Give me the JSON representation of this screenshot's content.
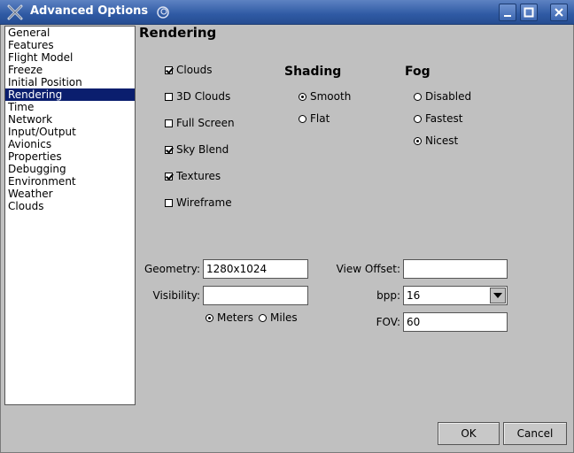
{
  "window": {
    "title": "Advanced Options"
  },
  "sidebar": {
    "items": [
      "General",
      "Features",
      "Flight Model",
      "Freeze",
      "Initial Position",
      "Rendering",
      "Time",
      "Network",
      "Input/Output",
      "Avionics",
      "Properties",
      "Debugging",
      "Environment",
      "Weather",
      "Clouds"
    ],
    "selected": "Rendering"
  },
  "panel": {
    "heading": "Rendering"
  },
  "options": {
    "clouds": {
      "label": "Clouds",
      "checked": true
    },
    "clouds3d": {
      "label": "3D Clouds",
      "checked": false
    },
    "fullscreen": {
      "label": "Full Screen",
      "checked": false
    },
    "skyblend": {
      "label": "Sky Blend",
      "checked": true
    },
    "textures": {
      "label": "Textures",
      "checked": true
    },
    "wireframe": {
      "label": "Wireframe",
      "checked": false
    }
  },
  "shading": {
    "heading": "Shading",
    "smooth": "Smooth",
    "flat": "Flat",
    "selected": "Smooth"
  },
  "fog": {
    "heading": "Fog",
    "disabled": "Disabled",
    "fastest": "Fastest",
    "nicest": "Nicest",
    "selected": "Nicest"
  },
  "fields": {
    "geometry_label": "Geometry:",
    "geometry_value": "1280x1024",
    "visibility_label": "Visibility:",
    "visibility_value": "",
    "view_offset_label": "View Offset:",
    "view_offset_value": "",
    "bpp_label": "bpp:",
    "bpp_value": "16",
    "fov_label": "FOV:",
    "fov_value": "60"
  },
  "units": {
    "meters": "Meters",
    "miles": "Miles",
    "selected": "Meters"
  },
  "buttons": {
    "ok": "OK",
    "cancel": "Cancel"
  }
}
